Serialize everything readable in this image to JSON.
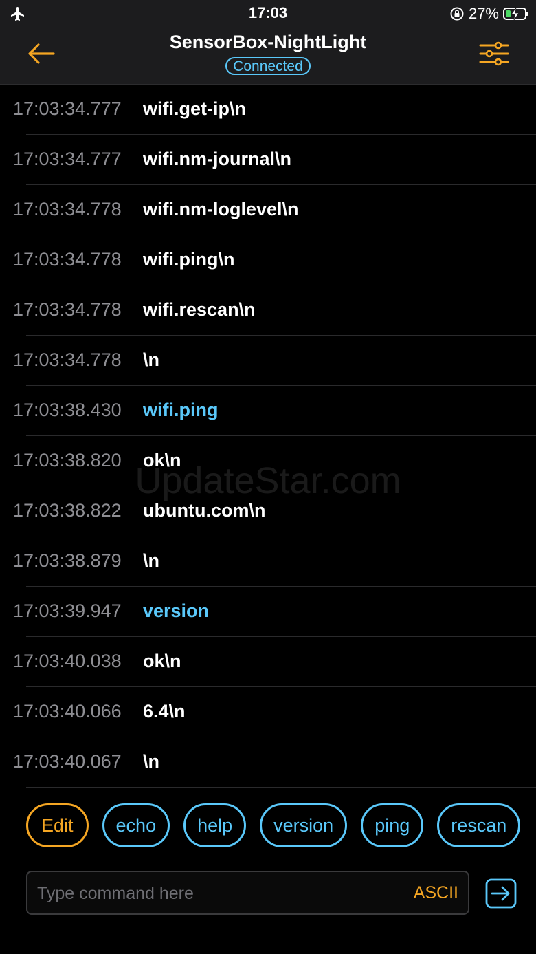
{
  "status_bar": {
    "time": "17:03",
    "battery_percent": "27%",
    "battery_level": 0.27,
    "airplane_icon": "airplane-icon",
    "lock_icon": "orientation-lock-icon"
  },
  "nav": {
    "title": "SensorBox-NightLight",
    "status": "Connected",
    "back_icon": "arrow-left-icon",
    "settings_icon": "sliders-icon"
  },
  "log": [
    {
      "time": "17:03:34.777",
      "message": "wifi.get-ip\\n",
      "direction": "received"
    },
    {
      "time": "17:03:34.777",
      "message": "wifi.nm-journal\\n",
      "direction": "received"
    },
    {
      "time": "17:03:34.778",
      "message": "wifi.nm-loglevel\\n",
      "direction": "received"
    },
    {
      "time": "17:03:34.778",
      "message": "wifi.ping\\n",
      "direction": "received"
    },
    {
      "time": "17:03:34.778",
      "message": "wifi.rescan\\n",
      "direction": "received"
    },
    {
      "time": "17:03:34.778",
      "message": "\\n",
      "direction": "received"
    },
    {
      "time": "17:03:38.430",
      "message": "wifi.ping",
      "direction": "sent"
    },
    {
      "time": "17:03:38.820",
      "message": "ok\\n",
      "direction": "received"
    },
    {
      "time": "17:03:38.822",
      "message": "ubuntu.com\\n",
      "direction": "received"
    },
    {
      "time": "17:03:38.879",
      "message": "\\n",
      "direction": "received"
    },
    {
      "time": "17:03:39.947",
      "message": "version",
      "direction": "sent"
    },
    {
      "time": "17:03:40.038",
      "message": "ok\\n",
      "direction": "received"
    },
    {
      "time": "17:03:40.066",
      "message": "6.4\\n",
      "direction": "received"
    },
    {
      "time": "17:03:40.067",
      "message": "\\n",
      "direction": "received"
    }
  ],
  "watermark": "UpdateStar.com",
  "chips": {
    "edit": "Edit",
    "items": [
      "echo",
      "help",
      "version",
      "ping",
      "rescan"
    ]
  },
  "input": {
    "placeholder": "Type command here",
    "value": "",
    "mode": "ASCII",
    "send_icon": "send-arrow-icon"
  },
  "colors": {
    "accent": "#f5a623",
    "sent": "#5ac8fa",
    "battery": "#4cd964",
    "background": "#000000"
  }
}
